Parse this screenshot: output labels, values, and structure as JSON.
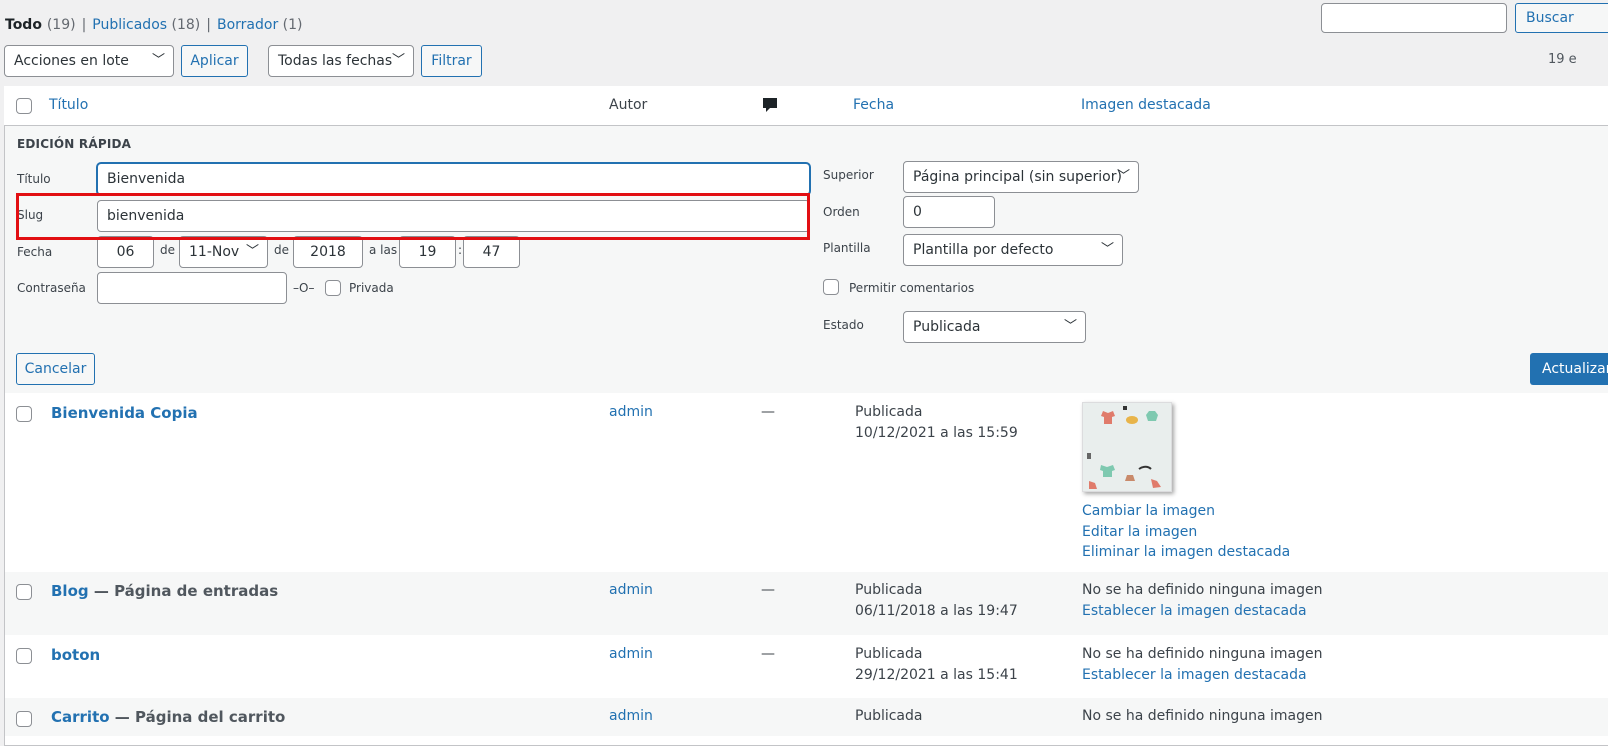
{
  "filters": {
    "all": "Todo",
    "all_count": "(19)",
    "published": "Publicados",
    "published_count": "(18)",
    "draft": "Borrador",
    "draft_count": "(1)"
  },
  "search": {
    "button": "Buscar"
  },
  "bulk_actions": {
    "selected": "Acciones en lote",
    "apply": "Aplicar"
  },
  "date_filter": {
    "selected": "Todas las fechas",
    "filter": "Filtrar"
  },
  "items_count": "19 e",
  "columns": {
    "title": "Título",
    "author": "Autor",
    "comments_icon": "comment-bubble-icon",
    "date": "Fecha",
    "featured_image": "Imagen destacada"
  },
  "quick_edit": {
    "heading": "EDICIÓN RÁPIDA",
    "title_label": "Título",
    "title_value": "Bienvenida",
    "slug_label": "Slug",
    "slug_value": "bienvenida",
    "date_label": "Fecha",
    "day": "06",
    "de1": "de",
    "month": "11-Nov",
    "de2": "de",
    "year": "2018",
    "at": "a las",
    "hour": "19",
    "colon": ":",
    "minute": "47",
    "password_label": "Contraseña",
    "or": "–O–",
    "private_label": "Privada",
    "parent_label": "Superior",
    "parent_value": "Página principal (sin superior)",
    "order_label": "Orden",
    "order_value": "0",
    "template_label": "Plantilla",
    "template_value": "Plantilla por defecto",
    "allow_comments": "Permitir comentarios",
    "status_label": "Estado",
    "status_value": "Publicada",
    "cancel": "Cancelar",
    "update": "Actualizar"
  },
  "rows": [
    {
      "title": "Bienvenida Copia",
      "suffix": "",
      "author": "admin",
      "comments": "—",
      "status": "Publicada",
      "date": "10/12/2021 a las 15:59",
      "image_links": [
        "Cambiar la imagen",
        "Editar la imagen",
        "Eliminar la imagen destacada"
      ]
    },
    {
      "title": "Blog",
      "suffix": " — Página de entradas",
      "author": "admin",
      "comments": "—",
      "status": "Publicada",
      "date": "06/11/2018 a las 19:47",
      "no_image": "No se ha definido ninguna imagen",
      "set_image": "Establecer la imagen destacada"
    },
    {
      "title": "boton",
      "suffix": "",
      "author": "admin",
      "comments": "—",
      "status": "Publicada",
      "date": "29/12/2021 a las 15:41",
      "no_image": "No se ha definido ninguna imagen",
      "set_image": "Establecer la imagen destacada"
    },
    {
      "title": "Carrito",
      "suffix": " — Página del carrito",
      "author": "admin",
      "status": "Publicada",
      "no_image": "No se ha definido ninguna imagen"
    }
  ],
  "colors": {
    "link": "#2271b1",
    "highlight": "#e20f13",
    "primary_button": "#2271b1"
  }
}
